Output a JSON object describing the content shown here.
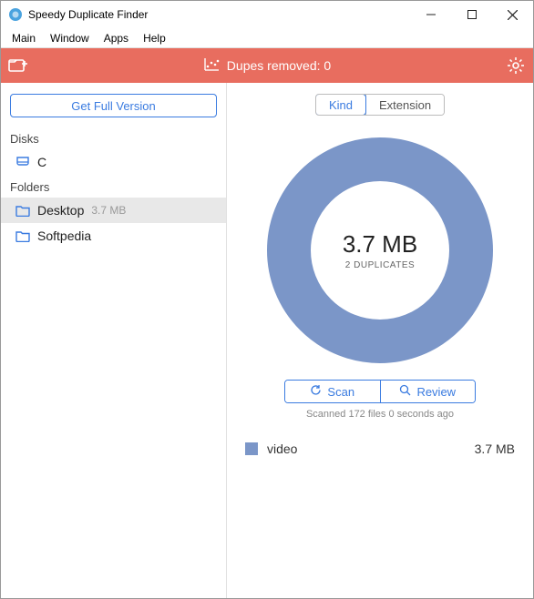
{
  "window": {
    "title": "Speedy Duplicate Finder"
  },
  "menubar": {
    "items": [
      "Main",
      "Window",
      "Apps",
      "Help"
    ]
  },
  "toolbar": {
    "status_label": "Dupes removed:",
    "status_count": "0"
  },
  "sidebar": {
    "full_version_label": "Get Full Version",
    "disks_header": "Disks",
    "disks": [
      {
        "name": "C"
      }
    ],
    "folders_header": "Folders",
    "folders": [
      {
        "name": "Desktop",
        "size": "3.7 MB",
        "selected": true
      },
      {
        "name": "Softpedia",
        "size": "",
        "selected": false
      }
    ]
  },
  "main": {
    "seg_kind": "Kind",
    "seg_extension": "Extension",
    "donut_size": "3.7 MB",
    "donut_dupes": "2 DUPLICATES",
    "scan_label": "Scan",
    "review_label": "Review",
    "scan_status": "Scanned 172 files 0 seconds ago",
    "legend": [
      {
        "label": "video",
        "size": "3.7 MB",
        "color": "#7b96c8"
      }
    ]
  },
  "chart_data": {
    "type": "pie",
    "title": "",
    "series": [
      {
        "name": "video",
        "value": 3.7,
        "unit": "MB",
        "color": "#7b96c8"
      }
    ],
    "total": {
      "value": 3.7,
      "unit": "MB",
      "duplicates": 2
    }
  }
}
